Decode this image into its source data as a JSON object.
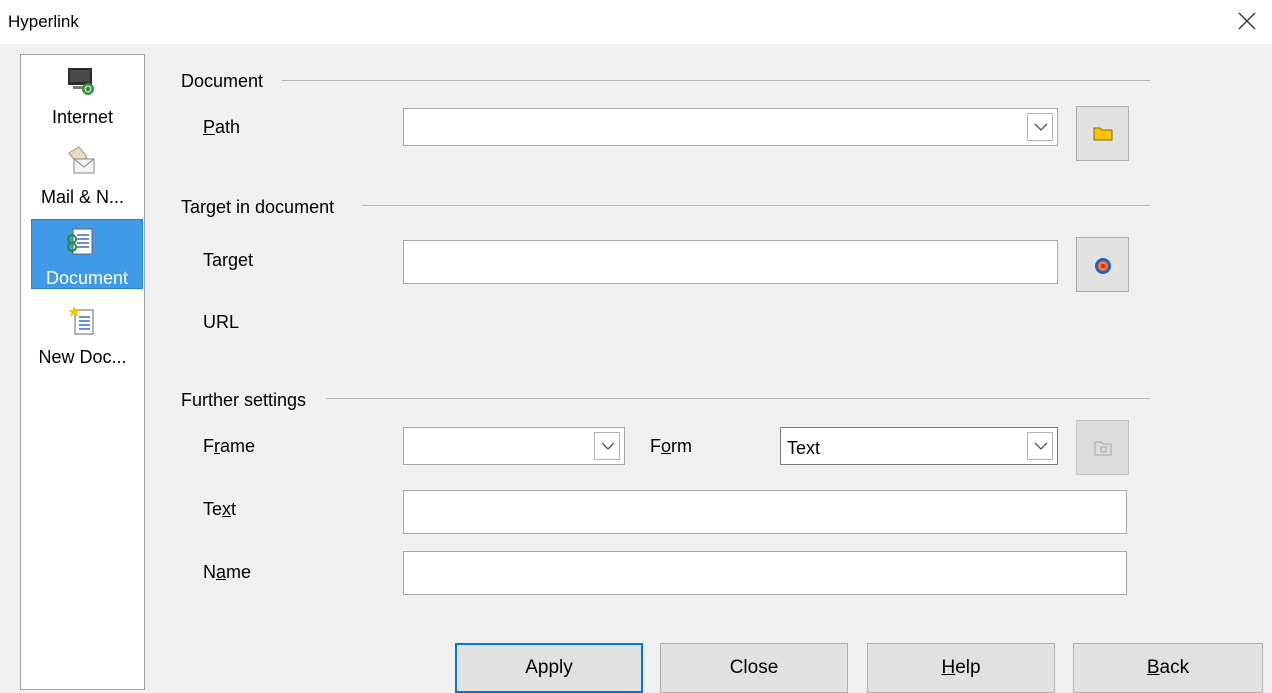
{
  "window": {
    "title": "Hyperlink"
  },
  "sidebar": {
    "items": [
      {
        "label": "Internet",
        "icon": "internet-icon"
      },
      {
        "label": "Mail & N...",
        "icon": "mail-news-icon"
      },
      {
        "label": "Document",
        "icon": "document-icon",
        "selected": true
      },
      {
        "label": "New Doc...",
        "icon": "new-document-icon"
      }
    ]
  },
  "document": {
    "heading": "Document",
    "path_label_ul": "P",
    "path_label_rest": "ath",
    "path_value": ""
  },
  "target_section": {
    "heading": "Target in document",
    "target_label_pre": "Tar",
    "target_label_ul": "g",
    "target_label_post": "et",
    "target_value": "",
    "url_label": "URL"
  },
  "further": {
    "heading": "Further settings",
    "frame_label_pre": "F",
    "frame_label_ul": "r",
    "frame_label_post": "ame",
    "frame_value": "",
    "form_label_pre": "F",
    "form_label_ul": "o",
    "form_label_post": "rm",
    "form_value": "Text",
    "text_label_pre": "Te",
    "text_label_ul": "x",
    "text_label_post": "t",
    "text_value": "",
    "name_label_pre": "N",
    "name_label_ul": "a",
    "name_label_post": "me",
    "name_value": ""
  },
  "buttons": {
    "apply": "Apply",
    "close": "Close",
    "help_ul": "H",
    "help_rest": "elp",
    "back_ul": "B",
    "back_rest": "ack"
  },
  "colors": {
    "selected_bg": "#3f9ae7",
    "default_button_border": "#0078d7",
    "folder_icon": "#f5c400"
  }
}
